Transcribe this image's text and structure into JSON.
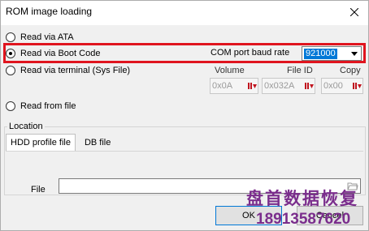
{
  "window": {
    "title": "ROM image loading"
  },
  "options": [
    {
      "label": "Read via ATA",
      "checked": false
    },
    {
      "label": "Read via Boot Code",
      "checked": true
    },
    {
      "label": "Read via terminal (Sys File)",
      "checked": false
    },
    {
      "label": "Read from file",
      "checked": false
    }
  ],
  "baud": {
    "label": "COM port baud rate",
    "value": "921000"
  },
  "terminal": {
    "volume": {
      "label": "Volume",
      "value": "0x0A"
    },
    "file_id": {
      "label": "File ID",
      "value": "0x032A"
    },
    "copy": {
      "label": "Copy",
      "value": "0x00"
    }
  },
  "location": {
    "title": "Location",
    "tabs": [
      {
        "label": "HDD profile file",
        "active": true
      },
      {
        "label": "DB file",
        "active": false
      }
    ],
    "file_label": "File",
    "file_value": ""
  },
  "buttons": {
    "ok": "OK",
    "cancel": "Cancel"
  },
  "watermark": {
    "line1": "盘首数据恢复",
    "line2": "18913587620"
  },
  "colors": {
    "highlight": "#e0141e",
    "selection": "#0078d7",
    "spin_arrow": "#c0141e",
    "watermark": "#7a2d8c"
  }
}
